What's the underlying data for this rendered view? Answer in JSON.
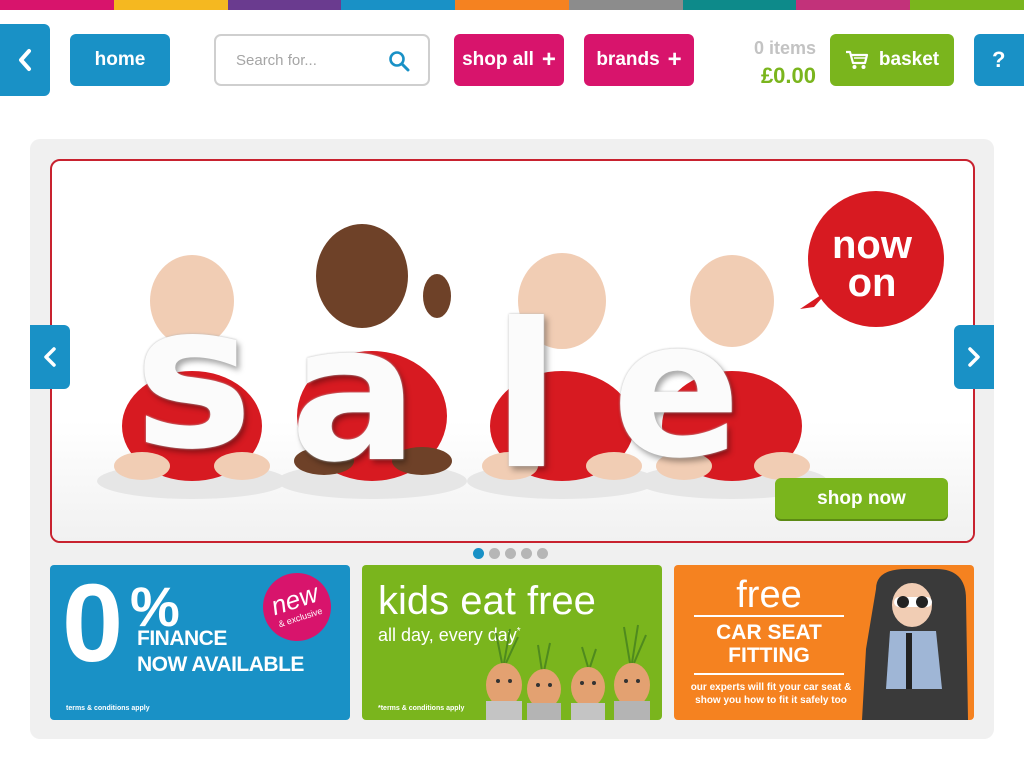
{
  "stripe_colors": [
    "#d8146c",
    "#f5b820",
    "#6a3b8f",
    "#1991c6",
    "#f58220",
    "#8c8c8c",
    "#0d8a8a",
    "#c2327a",
    "#7ab51d"
  ],
  "header": {
    "back_icon": "chevron-left-icon",
    "home_label": "home",
    "search_placeholder": "Search for...",
    "search_icon": "search-icon",
    "shop_all_label": "shop all",
    "brands_label": "brands",
    "plus_symbol": "+",
    "items_count": "0 items",
    "basket_total": "£0.00",
    "basket_label": "basket",
    "basket_icon": "shopping-cart-icon",
    "help_label": "?"
  },
  "hero": {
    "letters": [
      "s",
      "a",
      "l",
      "e"
    ],
    "badge_line1": "now",
    "badge_line2": "on",
    "cta_label": "shop now",
    "slide_count": 5,
    "active_slide": 0
  },
  "promos": {
    "finance": {
      "big": "0",
      "percent": "%",
      "line1": "FINANCE",
      "line2": "NOW AVAILABLE",
      "badge": "new",
      "badge_sub": "& exclusive",
      "terms": "terms & conditions apply"
    },
    "kids": {
      "title": "kids eat free",
      "subtitle": "all day, every day",
      "mark": "*",
      "terms": "*terms & conditions apply"
    },
    "car": {
      "title": "free",
      "line1": "CAR SEAT",
      "line2": "FITTING",
      "small": "our experts will fit your car seat & show you how to fit it safely too"
    }
  },
  "colors": {
    "blue": "#1991c6",
    "pink": "#d8146c",
    "green": "#7ab51d",
    "orange": "#f58220",
    "red": "#c8222f"
  }
}
